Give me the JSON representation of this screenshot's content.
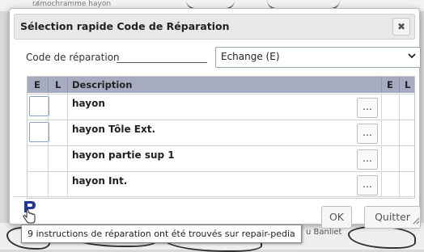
{
  "background": {
    "top_caption": "ra̸mochramme hayon",
    "bottom_caption": "u Banliet"
  },
  "dialog": {
    "title": "Sélection rapide Code de Réparation",
    "close_label": "✖"
  },
  "code": {
    "label": "Code de réparation",
    "selected": "Echange (E)",
    "chevron": "⌄"
  },
  "table": {
    "columns": [
      "E",
      "L",
      "Description",
      "E",
      "L"
    ],
    "rows": [
      {
        "description": "hayon",
        "e_checkbox": true,
        "more": "…"
      },
      {
        "description": "hayon Tôle Ext.",
        "e_checkbox": true,
        "more": "…"
      },
      {
        "description": "hayon partie sup 1",
        "e_checkbox": false,
        "more": "…"
      },
      {
        "description": "hayon Int.",
        "e_checkbox": false,
        "more": "…"
      }
    ]
  },
  "footer": {
    "ok_label": "OK",
    "quit_label": "Quitter",
    "tooltip": "9 instructions de réparation ont été trouvés sur repair-pedia"
  },
  "icons": {
    "logo": "repair-pedia-logo-icon",
    "pointer": "hand-pointer-icon",
    "resize": "resize-grip-icon"
  },
  "colors": {
    "header_bg": "#a7abbf",
    "logo_blue": "#1f3a93"
  }
}
